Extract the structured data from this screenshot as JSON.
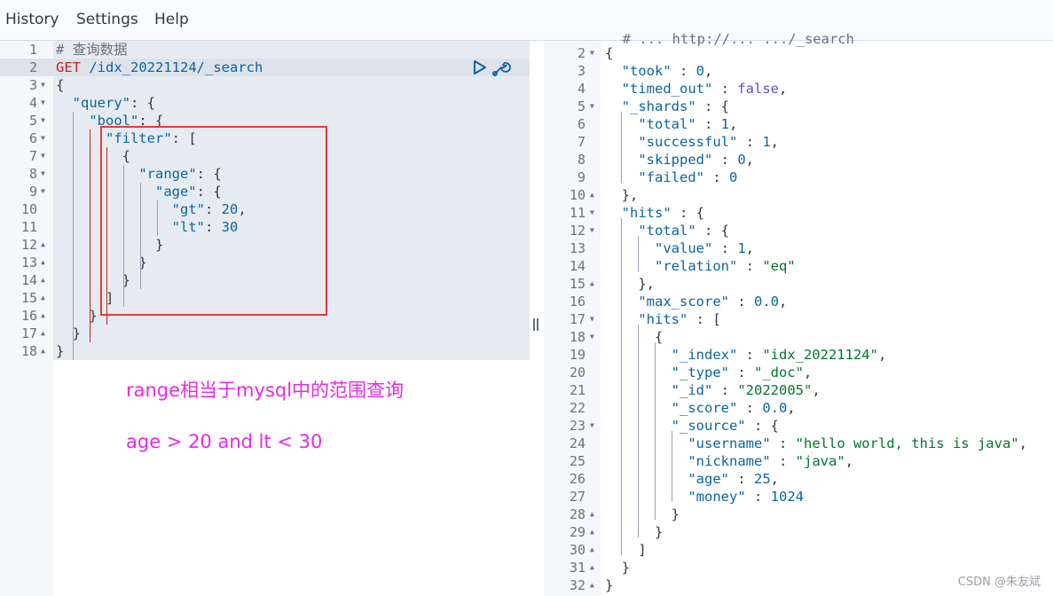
{
  "menu": {
    "history": "History",
    "settings": "Settings",
    "help": "Help"
  },
  "request": {
    "lines": [
      {
        "n": "1",
        "fold": "",
        "html": [
          [
            "c",
            "# 查询数据"
          ]
        ]
      },
      {
        "n": "2",
        "fold": "",
        "html": [
          [
            "m",
            "GET"
          ],
          [
            "p",
            " "
          ],
          [
            "u",
            "/idx_20221124/_search"
          ]
        ]
      },
      {
        "n": "3",
        "fold": "▼",
        "html": [
          [
            "p",
            "{"
          ]
        ]
      },
      {
        "n": "4",
        "fold": "▼",
        "html": [
          [
            "p",
            "  "
          ],
          [
            "k",
            "\"query\""
          ],
          [
            "p",
            ": {"
          ]
        ]
      },
      {
        "n": "5",
        "fold": "▼",
        "html": [
          [
            "p",
            "    "
          ],
          [
            "k",
            "\"bool\""
          ],
          [
            "p",
            ": {"
          ]
        ]
      },
      {
        "n": "6",
        "fold": "▼",
        "html": [
          [
            "p",
            "      "
          ],
          [
            "k",
            "\"filter\""
          ],
          [
            "p",
            ": ["
          ]
        ]
      },
      {
        "n": "7",
        "fold": "▼",
        "html": [
          [
            "p",
            "        {"
          ]
        ]
      },
      {
        "n": "8",
        "fold": "▼",
        "html": [
          [
            "p",
            "          "
          ],
          [
            "k",
            "\"range\""
          ],
          [
            "p",
            ": {"
          ]
        ]
      },
      {
        "n": "9",
        "fold": "▼",
        "html": [
          [
            "p",
            "            "
          ],
          [
            "k",
            "\"age\""
          ],
          [
            "p",
            ": {"
          ]
        ]
      },
      {
        "n": "10",
        "fold": "",
        "html": [
          [
            "p",
            "              "
          ],
          [
            "k",
            "\"gt\""
          ],
          [
            "p",
            ": "
          ],
          [
            "n",
            "20"
          ],
          [
            "p",
            ","
          ]
        ]
      },
      {
        "n": "11",
        "fold": "",
        "html": [
          [
            "p",
            "              "
          ],
          [
            "k",
            "\"lt\""
          ],
          [
            "p",
            ": "
          ],
          [
            "n",
            "30"
          ]
        ]
      },
      {
        "n": "12",
        "fold": "▲",
        "html": [
          [
            "p",
            "            }"
          ]
        ]
      },
      {
        "n": "13",
        "fold": "▲",
        "html": [
          [
            "p",
            "          }"
          ]
        ]
      },
      {
        "n": "14",
        "fold": "▲",
        "html": [
          [
            "p",
            "        }"
          ]
        ]
      },
      {
        "n": "15",
        "fold": "▲",
        "html": [
          [
            "p",
            "      ]"
          ]
        ]
      },
      {
        "n": "16",
        "fold": "▲",
        "html": [
          [
            "p",
            "    }"
          ]
        ]
      },
      {
        "n": "17",
        "fold": "▲",
        "html": [
          [
            "p",
            "  }"
          ]
        ]
      },
      {
        "n": "18",
        "fold": "▲",
        "html": [
          [
            "p",
            "}"
          ]
        ]
      }
    ]
  },
  "annotation": {
    "line1": "range相当于mysql中的范围查询",
    "line2": "age > 20 and lt < 30"
  },
  "response": {
    "partial_top": "  # ... http://... .../_search",
    "lines": [
      {
        "n": "2",
        "fold": "▼",
        "html": [
          [
            "p",
            "{"
          ]
        ]
      },
      {
        "n": "3",
        "fold": "",
        "html": [
          [
            "p",
            "  "
          ],
          [
            "k",
            "\"took\""
          ],
          [
            "p",
            " : "
          ],
          [
            "n",
            "0"
          ],
          [
            "p",
            ","
          ]
        ]
      },
      {
        "n": "4",
        "fold": "",
        "html": [
          [
            "p",
            "  "
          ],
          [
            "k",
            "\"timed_out\""
          ],
          [
            "p",
            " : "
          ],
          [
            "b",
            "false"
          ],
          [
            "p",
            ","
          ]
        ]
      },
      {
        "n": "5",
        "fold": "▼",
        "html": [
          [
            "p",
            "  "
          ],
          [
            "k",
            "\"_shards\""
          ],
          [
            "p",
            " : {"
          ]
        ]
      },
      {
        "n": "6",
        "fold": "",
        "html": [
          [
            "p",
            "    "
          ],
          [
            "k",
            "\"total\""
          ],
          [
            "p",
            " : "
          ],
          [
            "n",
            "1"
          ],
          [
            "p",
            ","
          ]
        ]
      },
      {
        "n": "7",
        "fold": "",
        "html": [
          [
            "p",
            "    "
          ],
          [
            "k",
            "\"successful\""
          ],
          [
            "p",
            " : "
          ],
          [
            "n",
            "1"
          ],
          [
            "p",
            ","
          ]
        ]
      },
      {
        "n": "8",
        "fold": "",
        "html": [
          [
            "p",
            "    "
          ],
          [
            "k",
            "\"skipped\""
          ],
          [
            "p",
            " : "
          ],
          [
            "n",
            "0"
          ],
          [
            "p",
            ","
          ]
        ]
      },
      {
        "n": "9",
        "fold": "",
        "html": [
          [
            "p",
            "    "
          ],
          [
            "k",
            "\"failed\""
          ],
          [
            "p",
            " : "
          ],
          [
            "n",
            "0"
          ]
        ]
      },
      {
        "n": "10",
        "fold": "▲",
        "html": [
          [
            "p",
            "  },"
          ]
        ]
      },
      {
        "n": "11",
        "fold": "▼",
        "html": [
          [
            "p",
            "  "
          ],
          [
            "k",
            "\"hits\""
          ],
          [
            "p",
            " : {"
          ]
        ]
      },
      {
        "n": "12",
        "fold": "▼",
        "html": [
          [
            "p",
            "    "
          ],
          [
            "k",
            "\"total\""
          ],
          [
            "p",
            " : {"
          ]
        ]
      },
      {
        "n": "13",
        "fold": "",
        "html": [
          [
            "p",
            "      "
          ],
          [
            "k",
            "\"value\""
          ],
          [
            "p",
            " : "
          ],
          [
            "n",
            "1"
          ],
          [
            "p",
            ","
          ]
        ]
      },
      {
        "n": "14",
        "fold": "",
        "html": [
          [
            "p",
            "      "
          ],
          [
            "k",
            "\"relation\""
          ],
          [
            "p",
            " : "
          ],
          [
            "s",
            "\"eq\""
          ]
        ]
      },
      {
        "n": "15",
        "fold": "▲",
        "html": [
          [
            "p",
            "    },"
          ]
        ]
      },
      {
        "n": "16",
        "fold": "",
        "html": [
          [
            "p",
            "    "
          ],
          [
            "k",
            "\"max_score\""
          ],
          [
            "p",
            " : "
          ],
          [
            "n",
            "0.0"
          ],
          [
            "p",
            ","
          ]
        ]
      },
      {
        "n": "17",
        "fold": "▼",
        "html": [
          [
            "p",
            "    "
          ],
          [
            "k",
            "\"hits\""
          ],
          [
            "p",
            " : ["
          ]
        ]
      },
      {
        "n": "18",
        "fold": "▼",
        "html": [
          [
            "p",
            "      {"
          ]
        ]
      },
      {
        "n": "19",
        "fold": "",
        "html": [
          [
            "p",
            "        "
          ],
          [
            "k",
            "\"_index\""
          ],
          [
            "p",
            " : "
          ],
          [
            "s",
            "\"idx_20221124\""
          ],
          [
            "p",
            ","
          ]
        ]
      },
      {
        "n": "20",
        "fold": "",
        "html": [
          [
            "p",
            "        "
          ],
          [
            "k",
            "\"_type\""
          ],
          [
            "p",
            " : "
          ],
          [
            "s",
            "\"_doc\""
          ],
          [
            "p",
            ","
          ]
        ]
      },
      {
        "n": "21",
        "fold": "",
        "html": [
          [
            "p",
            "        "
          ],
          [
            "k",
            "\"_id\""
          ],
          [
            "p",
            " : "
          ],
          [
            "s",
            "\"2022005\""
          ],
          [
            "p",
            ","
          ]
        ]
      },
      {
        "n": "22",
        "fold": "",
        "html": [
          [
            "p",
            "        "
          ],
          [
            "k",
            "\"_score\""
          ],
          [
            "p",
            " : "
          ],
          [
            "n",
            "0.0"
          ],
          [
            "p",
            ","
          ]
        ]
      },
      {
        "n": "23",
        "fold": "▼",
        "html": [
          [
            "p",
            "        "
          ],
          [
            "k",
            "\"_source\""
          ],
          [
            "p",
            " : {"
          ]
        ]
      },
      {
        "n": "24",
        "fold": "",
        "html": [
          [
            "p",
            "          "
          ],
          [
            "k",
            "\"username\""
          ],
          [
            "p",
            " : "
          ],
          [
            "s",
            "\"hello world, this is java\""
          ],
          [
            "p",
            ","
          ]
        ]
      },
      {
        "n": "25",
        "fold": "",
        "html": [
          [
            "p",
            "          "
          ],
          [
            "k",
            "\"nickname\""
          ],
          [
            "p",
            " : "
          ],
          [
            "s",
            "\"java\""
          ],
          [
            "p",
            ","
          ]
        ]
      },
      {
        "n": "26",
        "fold": "",
        "html": [
          [
            "p",
            "          "
          ],
          [
            "k",
            "\"age\""
          ],
          [
            "p",
            " : "
          ],
          [
            "n",
            "25"
          ],
          [
            "p",
            ","
          ]
        ]
      },
      {
        "n": "27",
        "fold": "",
        "html": [
          [
            "p",
            "          "
          ],
          [
            "k",
            "\"money\""
          ],
          [
            "p",
            " : "
          ],
          [
            "n",
            "1024"
          ]
        ]
      },
      {
        "n": "28",
        "fold": "▲",
        "html": [
          [
            "p",
            "        }"
          ]
        ]
      },
      {
        "n": "29",
        "fold": "▲",
        "html": [
          [
            "p",
            "      }"
          ]
        ]
      },
      {
        "n": "30",
        "fold": "▲",
        "html": [
          [
            "p",
            "    ]"
          ]
        ]
      },
      {
        "n": "31",
        "fold": "▲",
        "html": [
          [
            "p",
            "  }"
          ]
        ]
      },
      {
        "n": "32",
        "fold": "▲",
        "html": [
          [
            "p",
            "}"
          ]
        ]
      }
    ]
  },
  "watermark": "CSDN @朱友斌"
}
